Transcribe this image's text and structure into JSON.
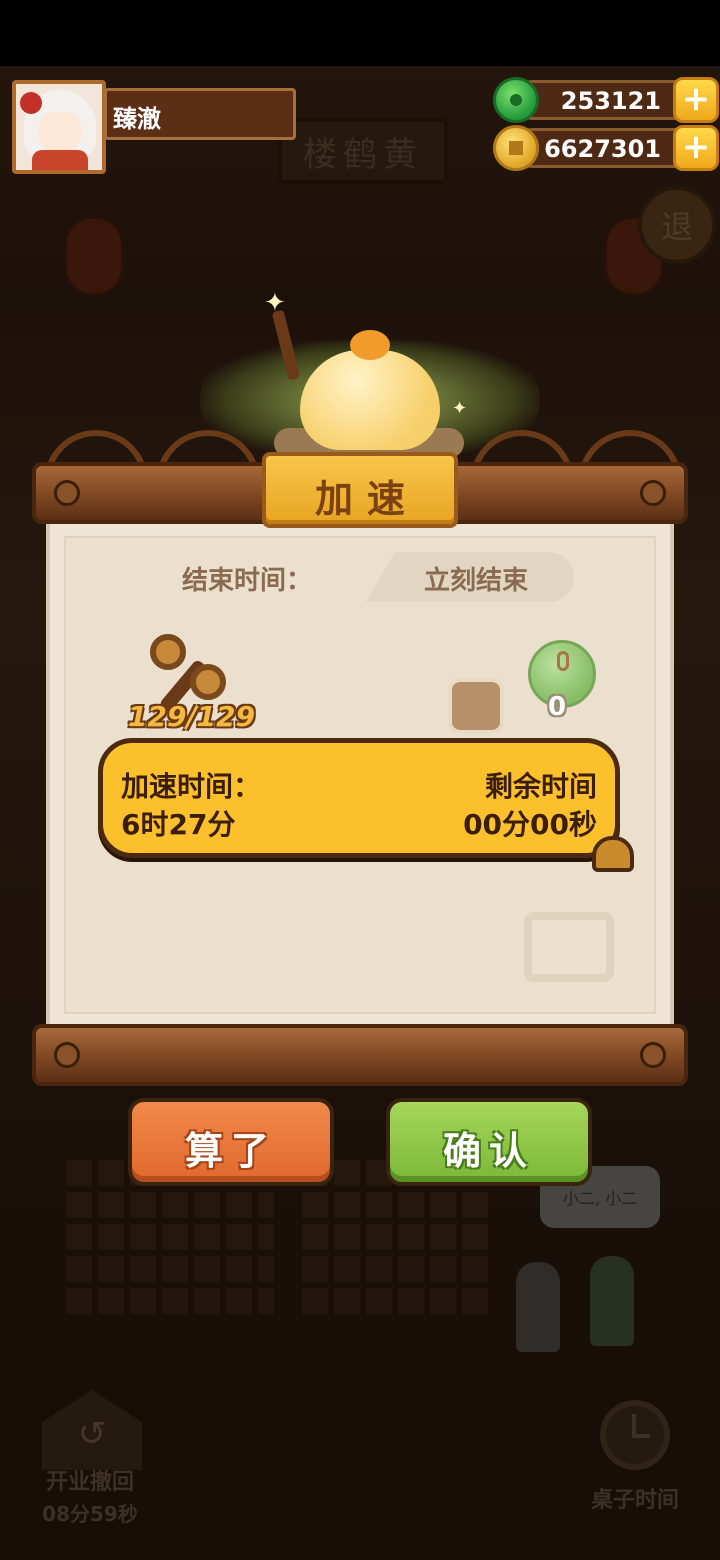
{
  "hud": {
    "player_name": "臻澈",
    "jade_amount": "253121",
    "coin_amount": "6627301",
    "plus_symbol": "+"
  },
  "background": {
    "sign_text": "楼鹤黄",
    "exit_label": "退",
    "speech_text": "小二, 小二",
    "open_undo_label": "开业撤回",
    "open_undo_timer": "08分59秒",
    "table_time_label": "桌子时间"
  },
  "dialog": {
    "title": "加速",
    "end_time_label": "结束时间：",
    "end_time_value": "立刻结束",
    "item_count": "129/129",
    "jade_cost": "0",
    "speedup_label": "加速时间：",
    "speedup_value": "6时27分",
    "remaining_label": "剩余时间",
    "remaining_value": "00分00秒",
    "cancel_label": "算了",
    "confirm_label": "确认"
  },
  "colors": {
    "accent_gold": "#fcc02c",
    "cancel_orange": "#e0682e",
    "confirm_green": "#7cb838",
    "wood_brown": "#7a4420"
  },
  "icons": [
    "jade-icon",
    "coin-icon",
    "plus-icon",
    "avatar",
    "gear-item-icon",
    "jade-item-icon",
    "undo-icon",
    "clock-icon"
  ]
}
